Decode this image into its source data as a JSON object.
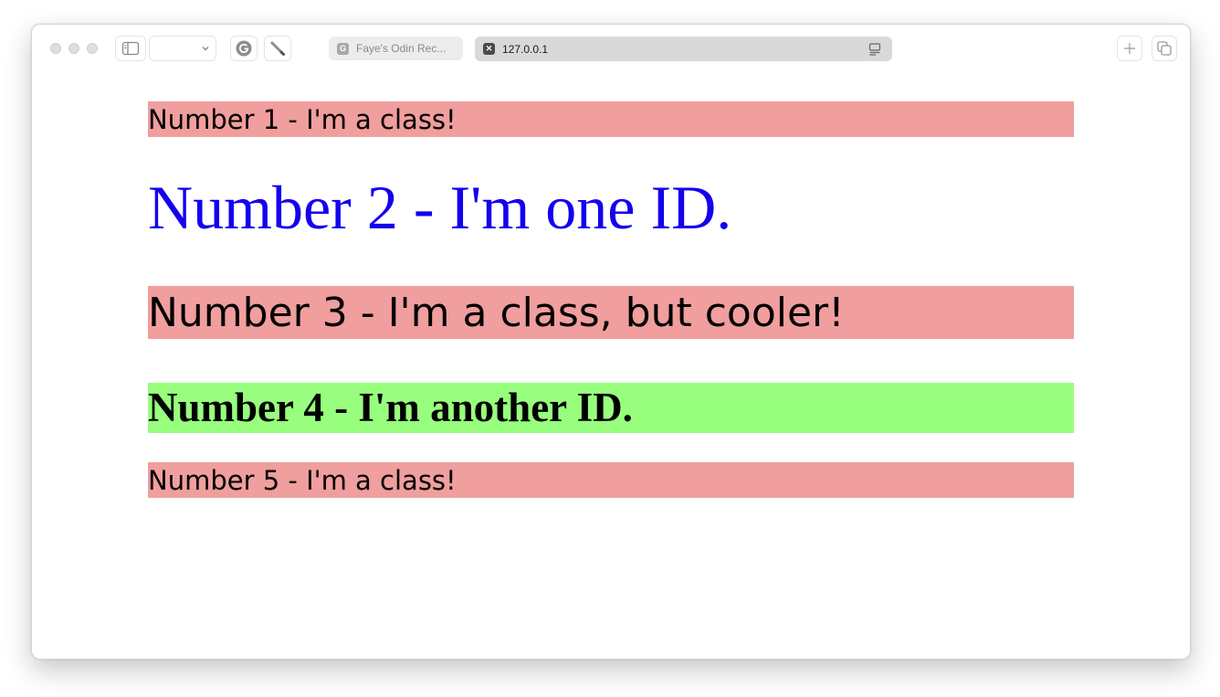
{
  "browser": {
    "tabs": [
      {
        "title": "Faye's Odin Rec...",
        "favicon_letter": "G",
        "active": false
      },
      {
        "title": "127.0.0.1",
        "favicon_letter": "✕",
        "active": true
      }
    ],
    "address": "127.0.0.1",
    "icons": {
      "sidebar": "sidebar-toggle-icon",
      "dropdown": "chevron-down-icon",
      "extension1": "grammarly-icon",
      "extension2": "pencil-icon",
      "reader": "reader-view-icon",
      "new_tab": "plus-icon",
      "tab_overview": "tab-overview-icon"
    }
  },
  "page": {
    "items": [
      {
        "text": "Number 1 - I'm a class!",
        "bg": "#f09e9e"
      },
      {
        "text": "Number 2 - I'm one ID.",
        "color": "#1400ee"
      },
      {
        "text": "Number 3 - I'm a class, but cooler!",
        "bg": "#f09e9e"
      },
      {
        "text": "Number 4 - I'm another ID.",
        "bg": "#98fe7e"
      },
      {
        "text": "Number 5 - I'm a class!",
        "bg": "#f09e9e"
      }
    ]
  }
}
